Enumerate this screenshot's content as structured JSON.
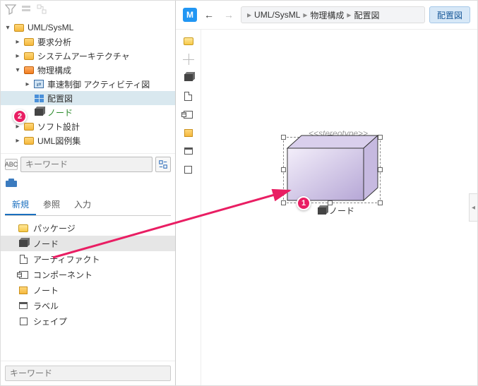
{
  "sidebar": {
    "root": "UML/SysML",
    "items": [
      {
        "label": "要求分析"
      },
      {
        "label": "システムアーキテクチャ"
      },
      {
        "label": "物理構成"
      },
      {
        "label": "車速制御 アクティビティ図"
      },
      {
        "label": "配置図"
      },
      {
        "label": "ノード"
      },
      {
        "label": "ソフト設計"
      },
      {
        "label": "UML図例集"
      }
    ],
    "search_placeholder": "キーワード",
    "kw_label": "ABC"
  },
  "palette": {
    "tabs": [
      "新規",
      "参照",
      "入力"
    ],
    "items": [
      {
        "label": "パッケージ"
      },
      {
        "label": "ノード"
      },
      {
        "label": "アーティファクト"
      },
      {
        "label": "コンポーネント"
      },
      {
        "label": "ノート"
      },
      {
        "label": "ラベル"
      },
      {
        "label": "シェイプ"
      }
    ],
    "bottom_search_placeholder": "キーワード"
  },
  "header": {
    "badge": "M",
    "breadcrumbs": [
      "UML/SysML",
      "物理構成",
      "配置図"
    ],
    "button": "配置図"
  },
  "canvas": {
    "stereotype": "<<stereotype>>",
    "node_label": "ノード"
  },
  "callouts": [
    "1",
    "2"
  ]
}
